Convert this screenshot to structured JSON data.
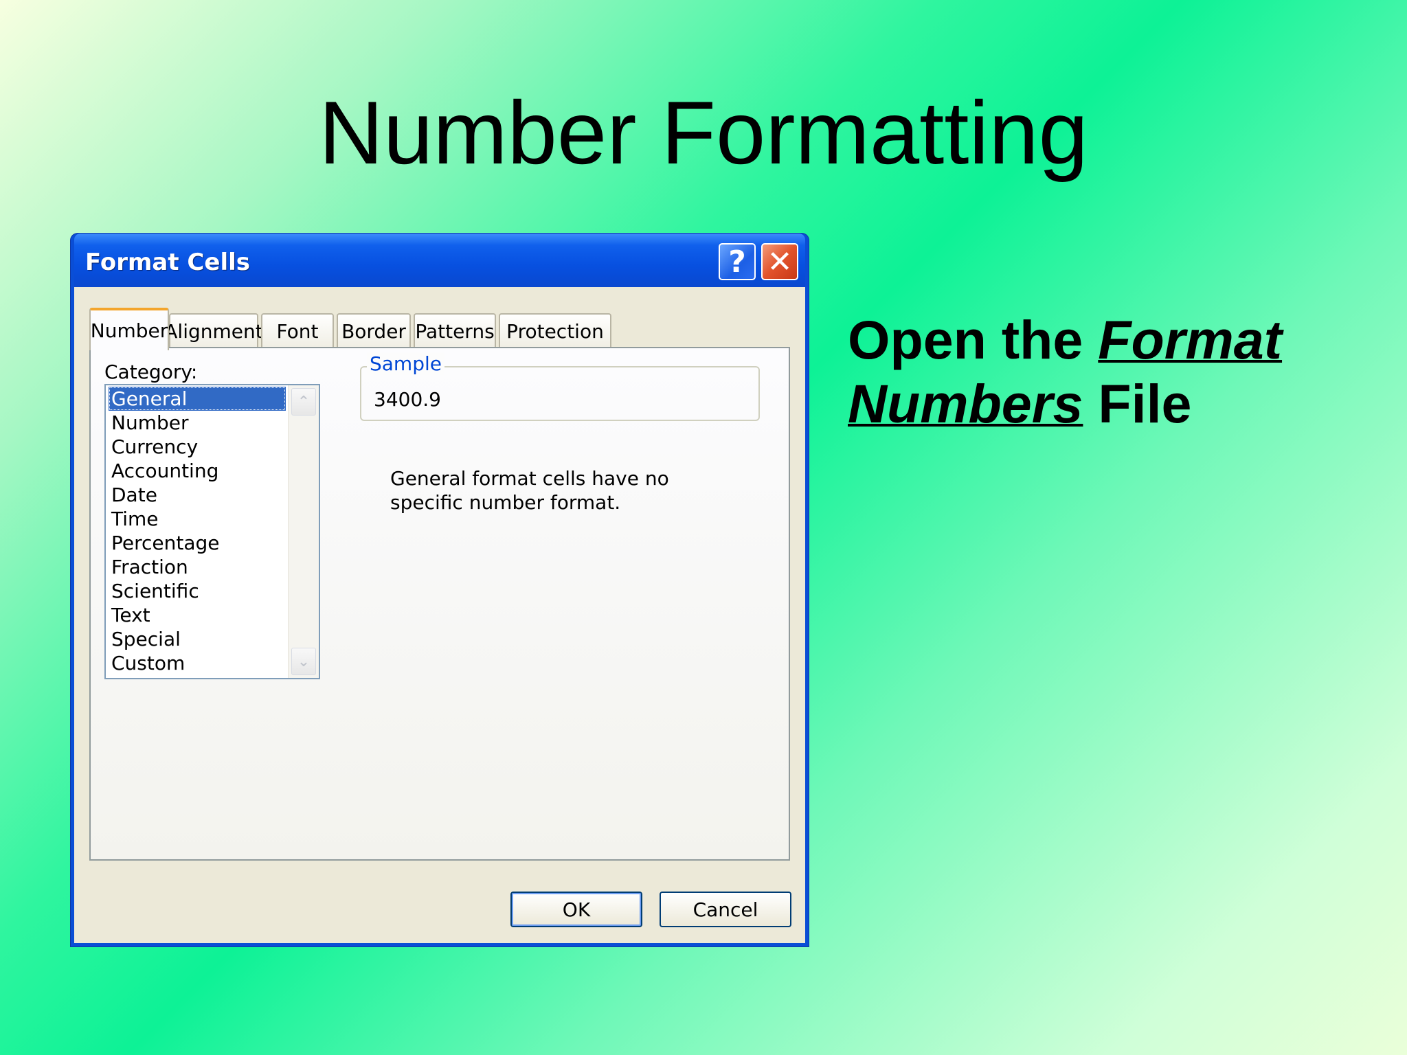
{
  "slide": {
    "title": "Number Formatting",
    "instruction": {
      "prefix": "Open the ",
      "link_text_1": "Format",
      "link_text_2": "Numbers",
      "suffix": " File"
    }
  },
  "dialog": {
    "title": "Format Cells",
    "help_glyph": "?",
    "close_glyph": "✕",
    "tabs": [
      "Number",
      "Alignment",
      "Font",
      "Border",
      "Patterns",
      "Protection"
    ],
    "active_tab": "Number",
    "category_label": "Category:",
    "categories": [
      "General",
      "Number",
      "Currency",
      "Accounting",
      "Date",
      "Time",
      "Percentage",
      "Fraction",
      "Scientific",
      "Text",
      "Special",
      "Custom"
    ],
    "selected_category": "General",
    "sample_label": "Sample",
    "sample_value": "3400.9",
    "description_line1": "General format cells have no",
    "description_line2": "specific number format.",
    "ok_label": "OK",
    "cancel_label": "Cancel",
    "scroll_up_glyph": "⌃",
    "scroll_down_glyph": "⌄"
  },
  "colors": {
    "titlebar": "#0a4ed6",
    "selection": "#316ac5",
    "active_tab_accent": "#f3a52c",
    "sample_label": "#0046d5",
    "close_button": "#e2532b"
  }
}
